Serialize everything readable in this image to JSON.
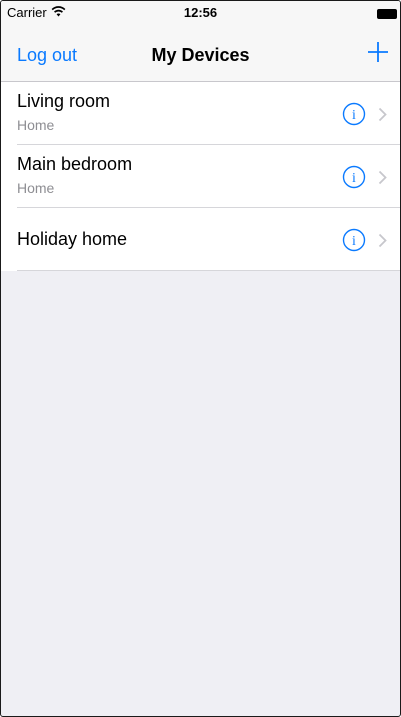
{
  "status_bar": {
    "carrier": "Carrier",
    "time": "12:56"
  },
  "nav": {
    "left_label": "Log out",
    "title": "My Devices",
    "right_icon": "plus-icon"
  },
  "devices": [
    {
      "name": "Living room",
      "subtitle": "Home"
    },
    {
      "name": "Main bedroom",
      "subtitle": "Home"
    },
    {
      "name": "Holiday home",
      "subtitle": ""
    }
  ],
  "colors": {
    "accent": "#0a7aff",
    "background": "#efeff4",
    "subtitle": "#8e8e93",
    "separator": "#d6d6da"
  }
}
